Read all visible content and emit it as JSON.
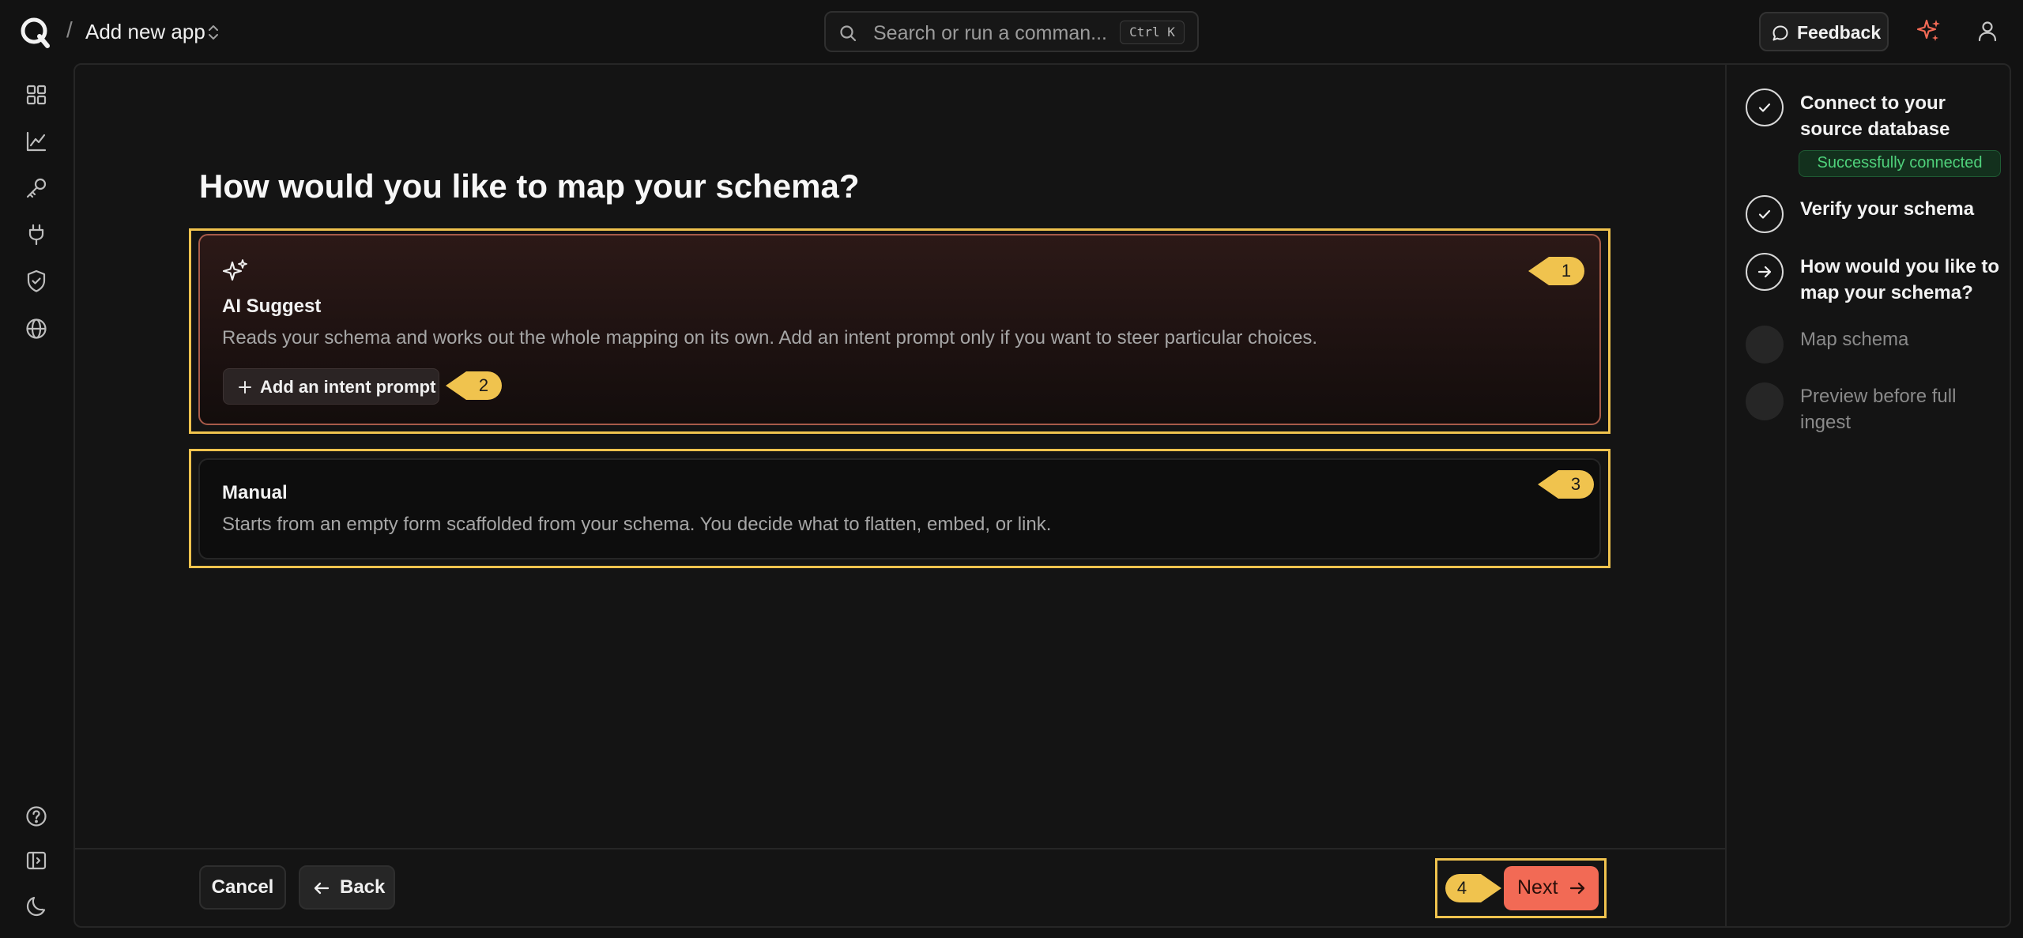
{
  "header": {
    "app_title": "Add new app",
    "breadcrumb_separator": "/",
    "search": {
      "placeholder": "Search or run a comman...",
      "shortcut": "Ctrl K"
    },
    "feedback_label": "Feedback"
  },
  "icons": {
    "logo": "logo-icon",
    "rail": [
      "grid-icon",
      "chart-icon",
      "key-icon",
      "plug-icon",
      "shield-icon",
      "globe-icon",
      "help-icon",
      "sidebar-toggle-icon",
      "moon-icon"
    ]
  },
  "main": {
    "title": "How would you like to map your schema?",
    "options": [
      {
        "title": "AI Suggest",
        "description": "Reads your schema and works out the whole mapping on its own. Add an intent prompt only if you want to steer particular choices.",
        "action_label": "Add an intent prompt",
        "selected": true
      },
      {
        "title": "Manual",
        "description": "Starts from an empty form scaffolded from your schema. You decide what to flatten, embed, or link.",
        "selected": false
      }
    ]
  },
  "footer": {
    "cancel_label": "Cancel",
    "back_label": "Back",
    "next_label": "Next"
  },
  "annotations": [
    "1",
    "2",
    "3",
    "4"
  ],
  "steps": [
    {
      "label": "Connect to your source database",
      "status": "done",
      "badge": "Successfully connected"
    },
    {
      "label": "Verify your schema",
      "status": "done"
    },
    {
      "label": "How would you like to map your schema?",
      "status": "current"
    },
    {
      "label": "Map schema",
      "status": "todo"
    },
    {
      "label": "Preview before full ingest",
      "status": "todo"
    }
  ],
  "colors": {
    "accent": "#f26a55",
    "annotation": "#f0c34e",
    "success": "#4fd17b",
    "background": "#121212"
  }
}
